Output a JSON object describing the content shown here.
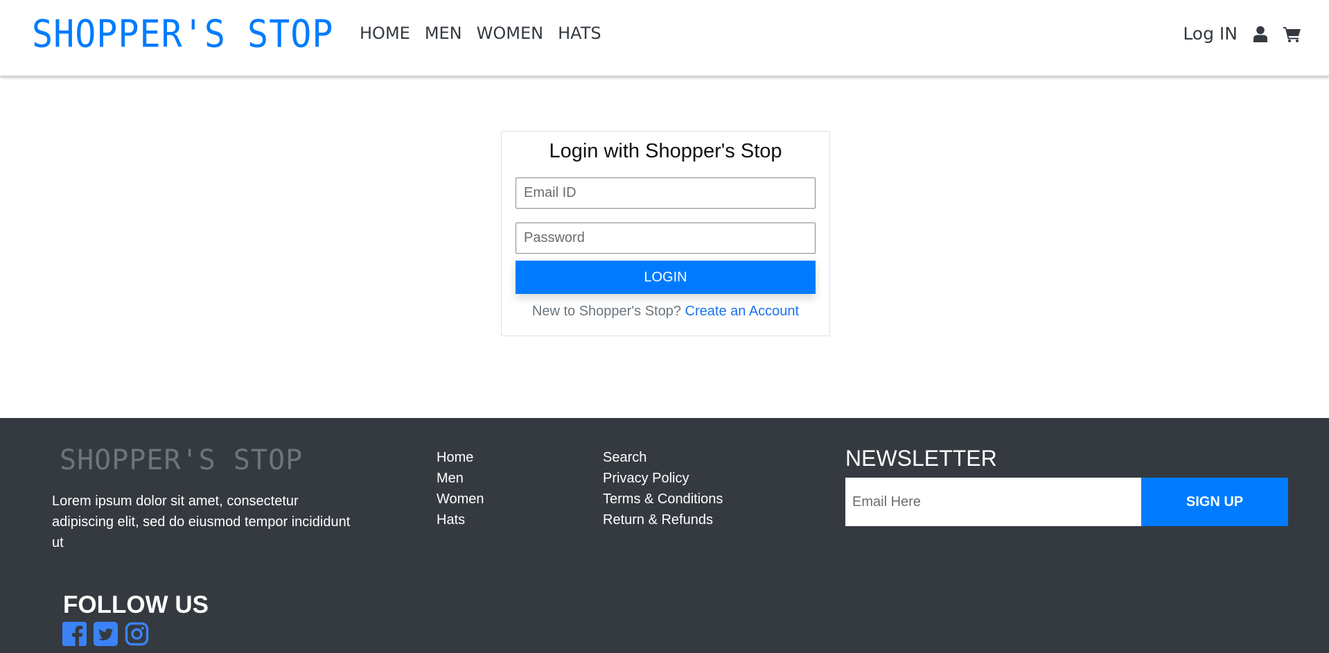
{
  "header": {
    "brand": "SHOPPER'S STOP",
    "nav": [
      "HOME",
      "MEN",
      "WOMEN",
      "HATS"
    ],
    "login_label": "Log IN",
    "icons": {
      "user": "user-icon",
      "cart": "cart-icon"
    }
  },
  "login_card": {
    "title": "Login with Shopper's Stop",
    "email_placeholder": "Email ID",
    "password_placeholder": "Password",
    "button_label": "LOGIN",
    "new_prompt": "New to Shopper's Stop?",
    "create_account": "Create an Account"
  },
  "footer": {
    "brand": "SHOPPER'S STOP",
    "about": "Lorem ipsum dolor sit amet, consectetur adipiscing elit, sed do eiusmod tempor incididunt ut",
    "links_col1": [
      "Home",
      "Men",
      "Women",
      "Hats"
    ],
    "links_col2": [
      "Search",
      "Privacy Policy",
      "Terms & Conditions",
      "Return & Refunds"
    ],
    "newsletter": {
      "title": "NEWSLETTER",
      "placeholder": "Email Here",
      "button_label": "SIGN UP"
    },
    "follow_title": "FOLLOW US",
    "social_icons": [
      "facebook-icon",
      "twitter-icon",
      "instagram-icon"
    ]
  },
  "colors": {
    "accent": "#007bff",
    "dark": "#343a40",
    "muted": "#6c757d"
  }
}
